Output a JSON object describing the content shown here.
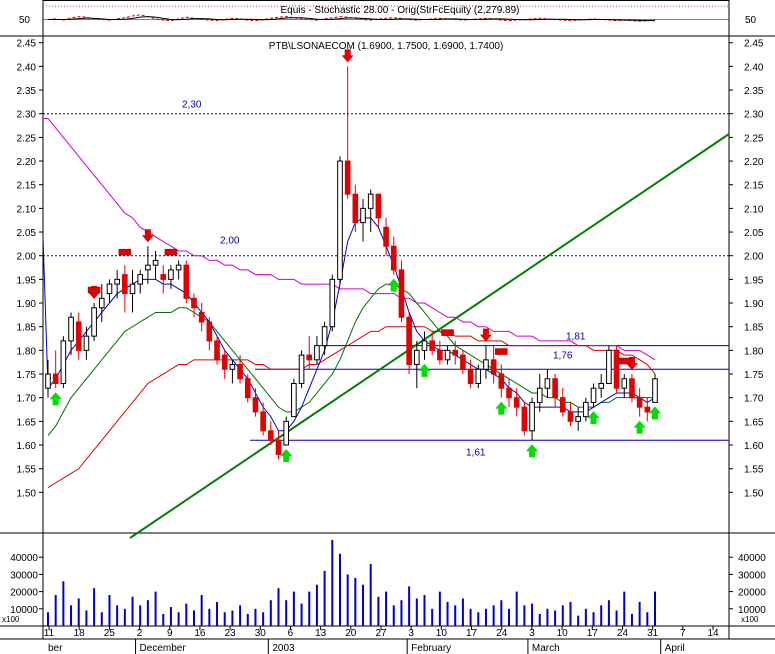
{
  "chart_data": {
    "type": "candlestick",
    "colors": {
      "bg": "#ffffff",
      "frame": "#000000",
      "up_candle": "#ffffff",
      "down_candle": "#e00000",
      "ma_blue": "#0000cc",
      "ma_green": "#007000",
      "ma_red": "#e00000",
      "ma_magenta": "#cc00cc",
      "trend": "#008000",
      "level": "#0000aa",
      "dotted": "#000080",
      "volume": "#0000cc",
      "buy_arrow": "#00dd00",
      "sell_arrow": "#e00000",
      "stoch_fast": "#cc0000",
      "stoch_slow": "#000000"
    },
    "top_panel": {
      "label": "Equis - Stochastic 28.00 - Orig(StrFcEquity (2,279.89)",
      "left_tick": "50",
      "right_tick": "50"
    },
    "price_panel": {
      "title": "PTB\\LSONAECOM (1.6900, 1.7500, 1.6900, 1.7400)",
      "ylim": [
        1.45,
        2.46
      ],
      "yticks": [
        1.5,
        1.55,
        1.6,
        1.65,
        1.7,
        1.75,
        1.8,
        1.85,
        1.9,
        1.95,
        2.0,
        2.05,
        2.1,
        2.15,
        2.2,
        2.25,
        2.3,
        2.35,
        2.4,
        2.45
      ],
      "levels": [
        {
          "value": 2.3,
          "label": "2,30",
          "style": "dotted"
        },
        {
          "value": 2.0,
          "label": "2,00",
          "style": "dotted"
        },
        {
          "value": 1.81,
          "label": "1,81",
          "style": "solid"
        },
        {
          "value": 1.76,
          "label": "1,76",
          "style": "solid"
        },
        {
          "value": 1.61,
          "label": "1,61",
          "style": "solid"
        }
      ]
    },
    "volume_panel": {
      "ylim": [
        0,
        50000
      ],
      "yticks": [
        10000,
        20000,
        30000,
        40000
      ],
      "unit_label": "x100"
    },
    "x_axis": {
      "day_ticks": [
        "11",
        "18",
        "25",
        "2",
        "9",
        "16",
        "23",
        "30",
        "6",
        "13",
        "20",
        "27",
        "3",
        "10",
        "17",
        "24",
        "3",
        "10",
        "17",
        "24",
        "31",
        "7",
        "14"
      ],
      "months": [
        {
          "label": "ber",
          "at": 0
        },
        {
          "label": "December",
          "at": 3
        },
        {
          "label": "2003",
          "at": 7.4
        },
        {
          "label": "February",
          "at": 12
        },
        {
          "label": "March",
          "at": 16
        },
        {
          "label": "April",
          "at": 20.4
        }
      ]
    },
    "ohlc": [
      [
        1.72,
        1.78,
        1.7,
        1.75
      ],
      [
        1.75,
        1.8,
        1.72,
        1.73
      ],
      [
        1.73,
        1.83,
        1.72,
        1.82
      ],
      [
        1.82,
        1.88,
        1.79,
        1.87
      ],
      [
        1.86,
        1.88,
        1.78,
        1.8
      ],
      [
        1.8,
        1.85,
        1.78,
        1.83
      ],
      [
        1.83,
        1.9,
        1.82,
        1.89
      ],
      [
        1.89,
        1.94,
        1.86,
        1.91
      ],
      [
        1.92,
        1.95,
        1.9,
        1.94
      ],
      [
        1.94,
        1.97,
        1.91,
        1.95
      ],
      [
        1.96,
        1.98,
        1.88,
        1.92
      ],
      [
        1.92,
        1.97,
        1.88,
        1.94
      ],
      [
        1.94,
        1.97,
        1.92,
        1.96
      ],
      [
        1.97,
        2.02,
        1.94,
        1.98
      ],
      [
        1.98,
        2.01,
        1.95,
        1.99
      ],
      [
        1.96,
        1.98,
        1.92,
        1.95
      ],
      [
        1.95,
        1.98,
        1.93,
        1.97
      ],
      [
        1.97,
        1.99,
        1.95,
        1.98
      ],
      [
        1.98,
        1.99,
        1.9,
        1.91
      ],
      [
        1.91,
        1.92,
        1.87,
        1.89
      ],
      [
        1.88,
        1.9,
        1.84,
        1.86
      ],
      [
        1.86,
        1.87,
        1.8,
        1.82
      ],
      [
        1.82,
        1.83,
        1.77,
        1.78
      ],
      [
        1.79,
        1.8,
        1.74,
        1.76
      ],
      [
        1.76,
        1.78,
        1.73,
        1.77
      ],
      [
        1.77,
        1.79,
        1.73,
        1.74
      ],
      [
        1.74,
        1.75,
        1.69,
        1.7
      ],
      [
        1.7,
        1.72,
        1.66,
        1.67
      ],
      [
        1.67,
        1.69,
        1.62,
        1.63
      ],
      [
        1.63,
        1.65,
        1.6,
        1.61
      ],
      [
        1.61,
        1.63,
        1.57,
        1.58
      ],
      [
        1.6,
        1.66,
        1.6,
        1.65
      ],
      [
        1.66,
        1.74,
        1.66,
        1.73
      ],
      [
        1.73,
        1.8,
        1.72,
        1.79
      ],
      [
        1.79,
        1.83,
        1.76,
        1.78
      ],
      [
        1.78,
        1.83,
        1.77,
        1.81
      ],
      [
        1.81,
        1.86,
        1.79,
        1.85
      ],
      [
        1.85,
        1.96,
        1.84,
        1.95
      ],
      [
        1.95,
        2.21,
        1.94,
        2.2
      ],
      [
        2.2,
        2.4,
        2.12,
        2.13
      ],
      [
        2.13,
        2.15,
        2.05,
        2.07
      ],
      [
        2.07,
        2.12,
        2.03,
        2.1
      ],
      [
        2.1,
        2.14,
        2.05,
        2.13
      ],
      [
        2.13,
        2.13,
        2.06,
        2.08
      ],
      [
        2.06,
        2.08,
        2.0,
        2.02
      ],
      [
        2.02,
        2.04,
        1.96,
        1.97
      ],
      [
        1.97,
        1.99,
        1.86,
        1.87
      ],
      [
        1.87,
        1.88,
        1.75,
        1.77
      ],
      [
        1.77,
        1.82,
        1.72,
        1.8
      ],
      [
        1.8,
        1.84,
        1.78,
        1.82
      ],
      [
        1.82,
        1.84,
        1.79,
        1.8
      ],
      [
        1.8,
        1.82,
        1.77,
        1.78
      ],
      [
        1.78,
        1.81,
        1.77,
        1.8
      ],
      [
        1.8,
        1.82,
        1.77,
        1.79
      ],
      [
        1.79,
        1.8,
        1.75,
        1.76
      ],
      [
        1.76,
        1.78,
        1.72,
        1.73
      ],
      [
        1.73,
        1.77,
        1.72,
        1.76
      ],
      [
        1.76,
        1.81,
        1.74,
        1.78
      ],
      [
        1.78,
        1.81,
        1.73,
        1.75
      ],
      [
        1.75,
        1.77,
        1.7,
        1.72
      ],
      [
        1.72,
        1.74,
        1.68,
        1.7
      ],
      [
        1.7,
        1.72,
        1.66,
        1.68
      ],
      [
        1.68,
        1.69,
        1.62,
        1.63
      ],
      [
        1.63,
        1.7,
        1.61,
        1.69
      ],
      [
        1.69,
        1.75,
        1.67,
        1.72
      ],
      [
        1.72,
        1.76,
        1.7,
        1.74
      ],
      [
        1.74,
        1.75,
        1.68,
        1.7
      ],
      [
        1.7,
        1.72,
        1.66,
        1.67
      ],
      [
        1.67,
        1.69,
        1.64,
        1.65
      ],
      [
        1.65,
        1.68,
        1.63,
        1.66
      ],
      [
        1.66,
        1.7,
        1.65,
        1.69
      ],
      [
        1.69,
        1.73,
        1.68,
        1.72
      ],
      [
        1.72,
        1.75,
        1.7,
        1.73
      ],
      [
        1.73,
        1.81,
        1.73,
        1.8
      ],
      [
        1.8,
        1.81,
        1.71,
        1.72
      ],
      [
        1.72,
        1.75,
        1.7,
        1.74
      ],
      [
        1.74,
        1.75,
        1.69,
        1.7
      ],
      [
        1.7,
        1.72,
        1.66,
        1.68
      ],
      [
        1.68,
        1.7,
        1.65,
        1.67
      ],
      [
        1.69,
        1.75,
        1.69,
        1.74
      ]
    ],
    "volume": [
      800,
      1800,
      2600,
      1200,
      1600,
      900,
      2200,
      800,
      1800,
      1200,
      1000,
      1700,
      1200,
      1500,
      2000,
      700,
      1100,
      800,
      1300,
      900,
      1800,
      1000,
      1400,
      800,
      900,
      1200,
      700,
      1000,
      800,
      1500,
      2200,
      1500,
      2000,
      1300,
      2000,
      2400,
      3200,
      5000,
      4200,
      3000,
      2800,
      2400,
      3600,
      1700,
      2000,
      1200,
      1500,
      2300,
      1600,
      1800,
      1000,
      2000,
      1400,
      1200,
      1600,
      1000,
      800,
      1000,
      1200,
      1500,
      1000,
      2000,
      1200,
      1300,
      700,
      1000,
      900,
      1200,
      1400,
      600,
      1000,
      800,
      1200,
      1500,
      900,
      2000,
      700,
      1400,
      800,
      2000
    ],
    "ma_blue": [
      1.72,
      1.74,
      1.77,
      1.8,
      1.82,
      1.84,
      1.86,
      1.88,
      1.9,
      1.92,
      1.93,
      1.94,
      1.95,
      1.95,
      1.95,
      1.94,
      1.94,
      1.93,
      1.92,
      1.9,
      1.88,
      1.86,
      1.83,
      1.8,
      1.78,
      1.76,
      1.74,
      1.71,
      1.68,
      1.66,
      1.63,
      1.63,
      1.65,
      1.68,
      1.72,
      1.76,
      1.8,
      1.86,
      1.94,
      2.03,
      2.07,
      2.08,
      2.08,
      2.06,
      2.02,
      1.98,
      1.93,
      1.88,
      1.84,
      1.82,
      1.81,
      1.8,
      1.8,
      1.79,
      1.78,
      1.77,
      1.76,
      1.76,
      1.75,
      1.74,
      1.72,
      1.71,
      1.69,
      1.68,
      1.68,
      1.68,
      1.68,
      1.68,
      1.67,
      1.67,
      1.67,
      1.68,
      1.69,
      1.7,
      1.71,
      1.71,
      1.71,
      1.7,
      1.69,
      1.7
    ],
    "ma_green": [
      1.62,
      1.64,
      1.67,
      1.7,
      1.72,
      1.74,
      1.76,
      1.78,
      1.8,
      1.82,
      1.84,
      1.85,
      1.86,
      1.87,
      1.88,
      1.88,
      1.88,
      1.89,
      1.89,
      1.88,
      1.87,
      1.86,
      1.84,
      1.82,
      1.8,
      1.78,
      1.76,
      1.74,
      1.72,
      1.7,
      1.68,
      1.67,
      1.67,
      1.68,
      1.69,
      1.71,
      1.73,
      1.75,
      1.78,
      1.82,
      1.86,
      1.89,
      1.91,
      1.93,
      1.94,
      1.94,
      1.93,
      1.92,
      1.9,
      1.88,
      1.86,
      1.84,
      1.83,
      1.81,
      1.8,
      1.79,
      1.78,
      1.77,
      1.76,
      1.75,
      1.74,
      1.73,
      1.72,
      1.71,
      1.71,
      1.7,
      1.7,
      1.69,
      1.69,
      1.68,
      1.68,
      1.68,
      1.69,
      1.69,
      1.7,
      1.7,
      1.7,
      1.7,
      1.7,
      1.7
    ],
    "ma_red": [
      1.51,
      1.52,
      1.53,
      1.54,
      1.55,
      1.57,
      1.59,
      1.61,
      1.63,
      1.65,
      1.67,
      1.69,
      1.71,
      1.73,
      1.74,
      1.75,
      1.76,
      1.77,
      1.77,
      1.78,
      1.78,
      1.78,
      1.78,
      1.78,
      1.78,
      1.78,
      1.78,
      1.77,
      1.77,
      1.76,
      1.76,
      1.76,
      1.76,
      1.76,
      1.77,
      1.77,
      1.78,
      1.79,
      1.8,
      1.81,
      1.82,
      1.83,
      1.84,
      1.84,
      1.85,
      1.85,
      1.85,
      1.85,
      1.85,
      1.85,
      1.84,
      1.84,
      1.84,
      1.83,
      1.83,
      1.83,
      1.82,
      1.82,
      1.82,
      1.82,
      1.81,
      1.81,
      1.81,
      1.81,
      1.81,
      1.81,
      1.81,
      1.81,
      1.81,
      1.81,
      1.81,
      1.8,
      1.8,
      1.8,
      1.8,
      1.79,
      1.79,
      1.78,
      1.77,
      1.75
    ],
    "ma_magenta": [
      2.29,
      2.27,
      2.25,
      2.23,
      2.21,
      2.19,
      2.17,
      2.15,
      2.13,
      2.11,
      2.09,
      2.08,
      2.06,
      2.05,
      2.04,
      2.03,
      2.02,
      2.01,
      2.01,
      2.0,
      2.0,
      1.99,
      1.99,
      1.98,
      1.98,
      1.97,
      1.97,
      1.96,
      1.96,
      1.96,
      1.95,
      1.95,
      1.95,
      1.94,
      1.94,
      1.94,
      1.94,
      1.94,
      1.93,
      1.93,
      1.93,
      1.93,
      1.92,
      1.92,
      1.92,
      1.92,
      1.91,
      1.91,
      1.9,
      1.9,
      1.89,
      1.88,
      1.87,
      1.87,
      1.86,
      1.86,
      1.85,
      1.85,
      1.84,
      1.84,
      1.84,
      1.83,
      1.83,
      1.83,
      1.82,
      1.82,
      1.82,
      1.82,
      1.82,
      1.81,
      1.81,
      1.81,
      1.81,
      1.81,
      1.81,
      1.8,
      1.8,
      1.8,
      1.79,
      1.78
    ],
    "stoch_fast": [
      50,
      52,
      48,
      55,
      60,
      58,
      52,
      50,
      48,
      52,
      56,
      62,
      66,
      60,
      52,
      48,
      46,
      52,
      58,
      54,
      50,
      48,
      46,
      50,
      54,
      52,
      48,
      46,
      50,
      54,
      58,
      60,
      56,
      52,
      50,
      48,
      52,
      56,
      60,
      58,
      54,
      50,
      48,
      52,
      54,
      56,
      54,
      50,
      48,
      50,
      52,
      54,
      52,
      50,
      48,
      50,
      52,
      54,
      52,
      48,
      46,
      48,
      50,
      52,
      54,
      52,
      50,
      48,
      46,
      48,
      50,
      52,
      50,
      48,
      46,
      48,
      46,
      44,
      46,
      48
    ],
    "stoch_slow": [
      50,
      50,
      50,
      51,
      53,
      55,
      54,
      52,
      50,
      50,
      51,
      54,
      58,
      60,
      58,
      54,
      50,
      49,
      51,
      53,
      53,
      52,
      50,
      49,
      50,
      51,
      51,
      50,
      49,
      50,
      52,
      55,
      56,
      56,
      54,
      51,
      50,
      51,
      53,
      55,
      55,
      54,
      52,
      50,
      50,
      51,
      52,
      52,
      51,
      50,
      50,
      51,
      52,
      52,
      51,
      50,
      50,
      51,
      52,
      52,
      51,
      50,
      49,
      49,
      50,
      51,
      51,
      51,
      50,
      49,
      49,
      50,
      50,
      50,
      49,
      48,
      48,
      47,
      46,
      46
    ],
    "buy_arrows": [
      1,
      31,
      45,
      49,
      59,
      63,
      71,
      77,
      79
    ],
    "sell_arrows": [
      6,
      13,
      39,
      57,
      76
    ],
    "markers": [
      6,
      10,
      16,
      52,
      59,
      75
    ]
  }
}
